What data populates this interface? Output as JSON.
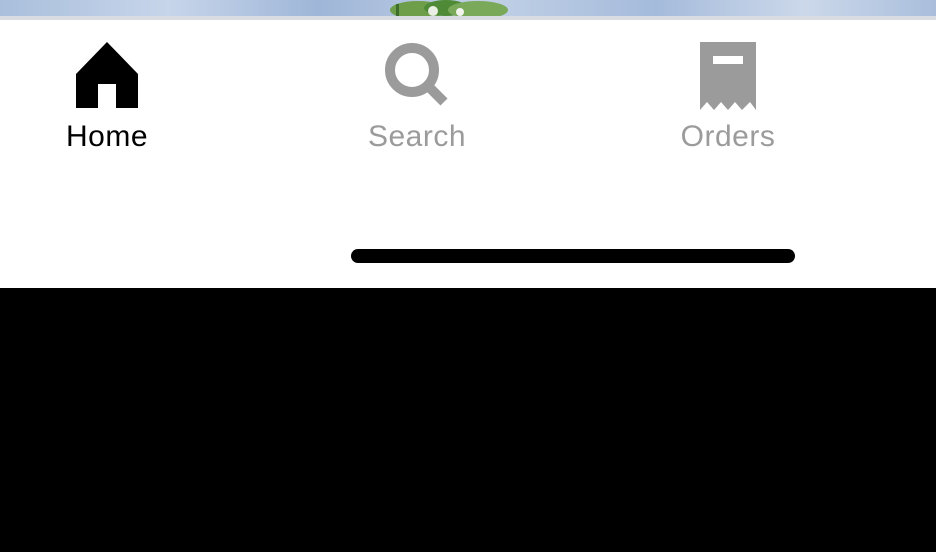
{
  "tab_bar": {
    "tabs": [
      {
        "label": "Home",
        "icon": "home-icon",
        "active": true
      },
      {
        "label": "Search",
        "icon": "search-icon",
        "active": false
      },
      {
        "label": "Orders",
        "icon": "receipt-icon",
        "active": false
      }
    ]
  },
  "colors": {
    "active": "#000000",
    "inactive": "#9b9b9b",
    "background": "#ffffff"
  }
}
